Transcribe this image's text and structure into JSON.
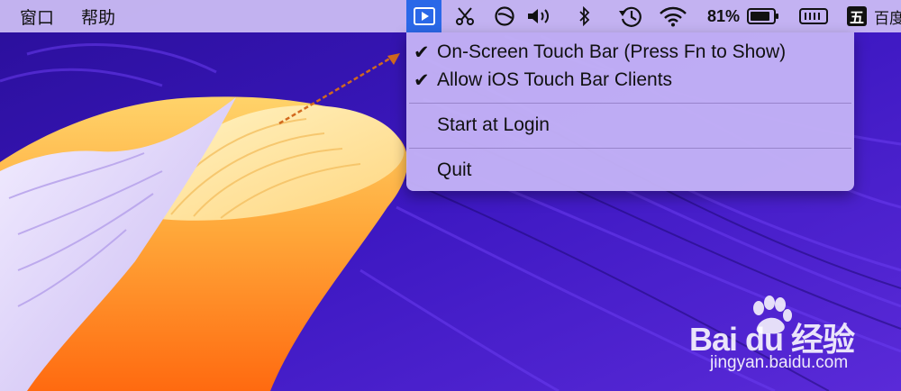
{
  "menubar": {
    "app_menus": [
      "窗口",
      "帮助"
    ],
    "battery_percent": "81%",
    "input_method": "五",
    "truncated_label": "百度"
  },
  "touchbar_menu": {
    "items": [
      {
        "label": "On-Screen Touch Bar (Press Fn to Show)",
        "checked": true
      },
      {
        "label": "Allow iOS Touch Bar Clients",
        "checked": true
      },
      {
        "label": "Start at Login",
        "checked": false
      },
      {
        "label": "Quit",
        "checked": false
      }
    ]
  },
  "watermark": {
    "brand": "Bai du 经验",
    "url": "jingyan.baidu.com"
  },
  "colors": {
    "accent": "#2a68e8",
    "arrow": "#d2691e",
    "wallpaper_purple": "#4a1fc0"
  }
}
